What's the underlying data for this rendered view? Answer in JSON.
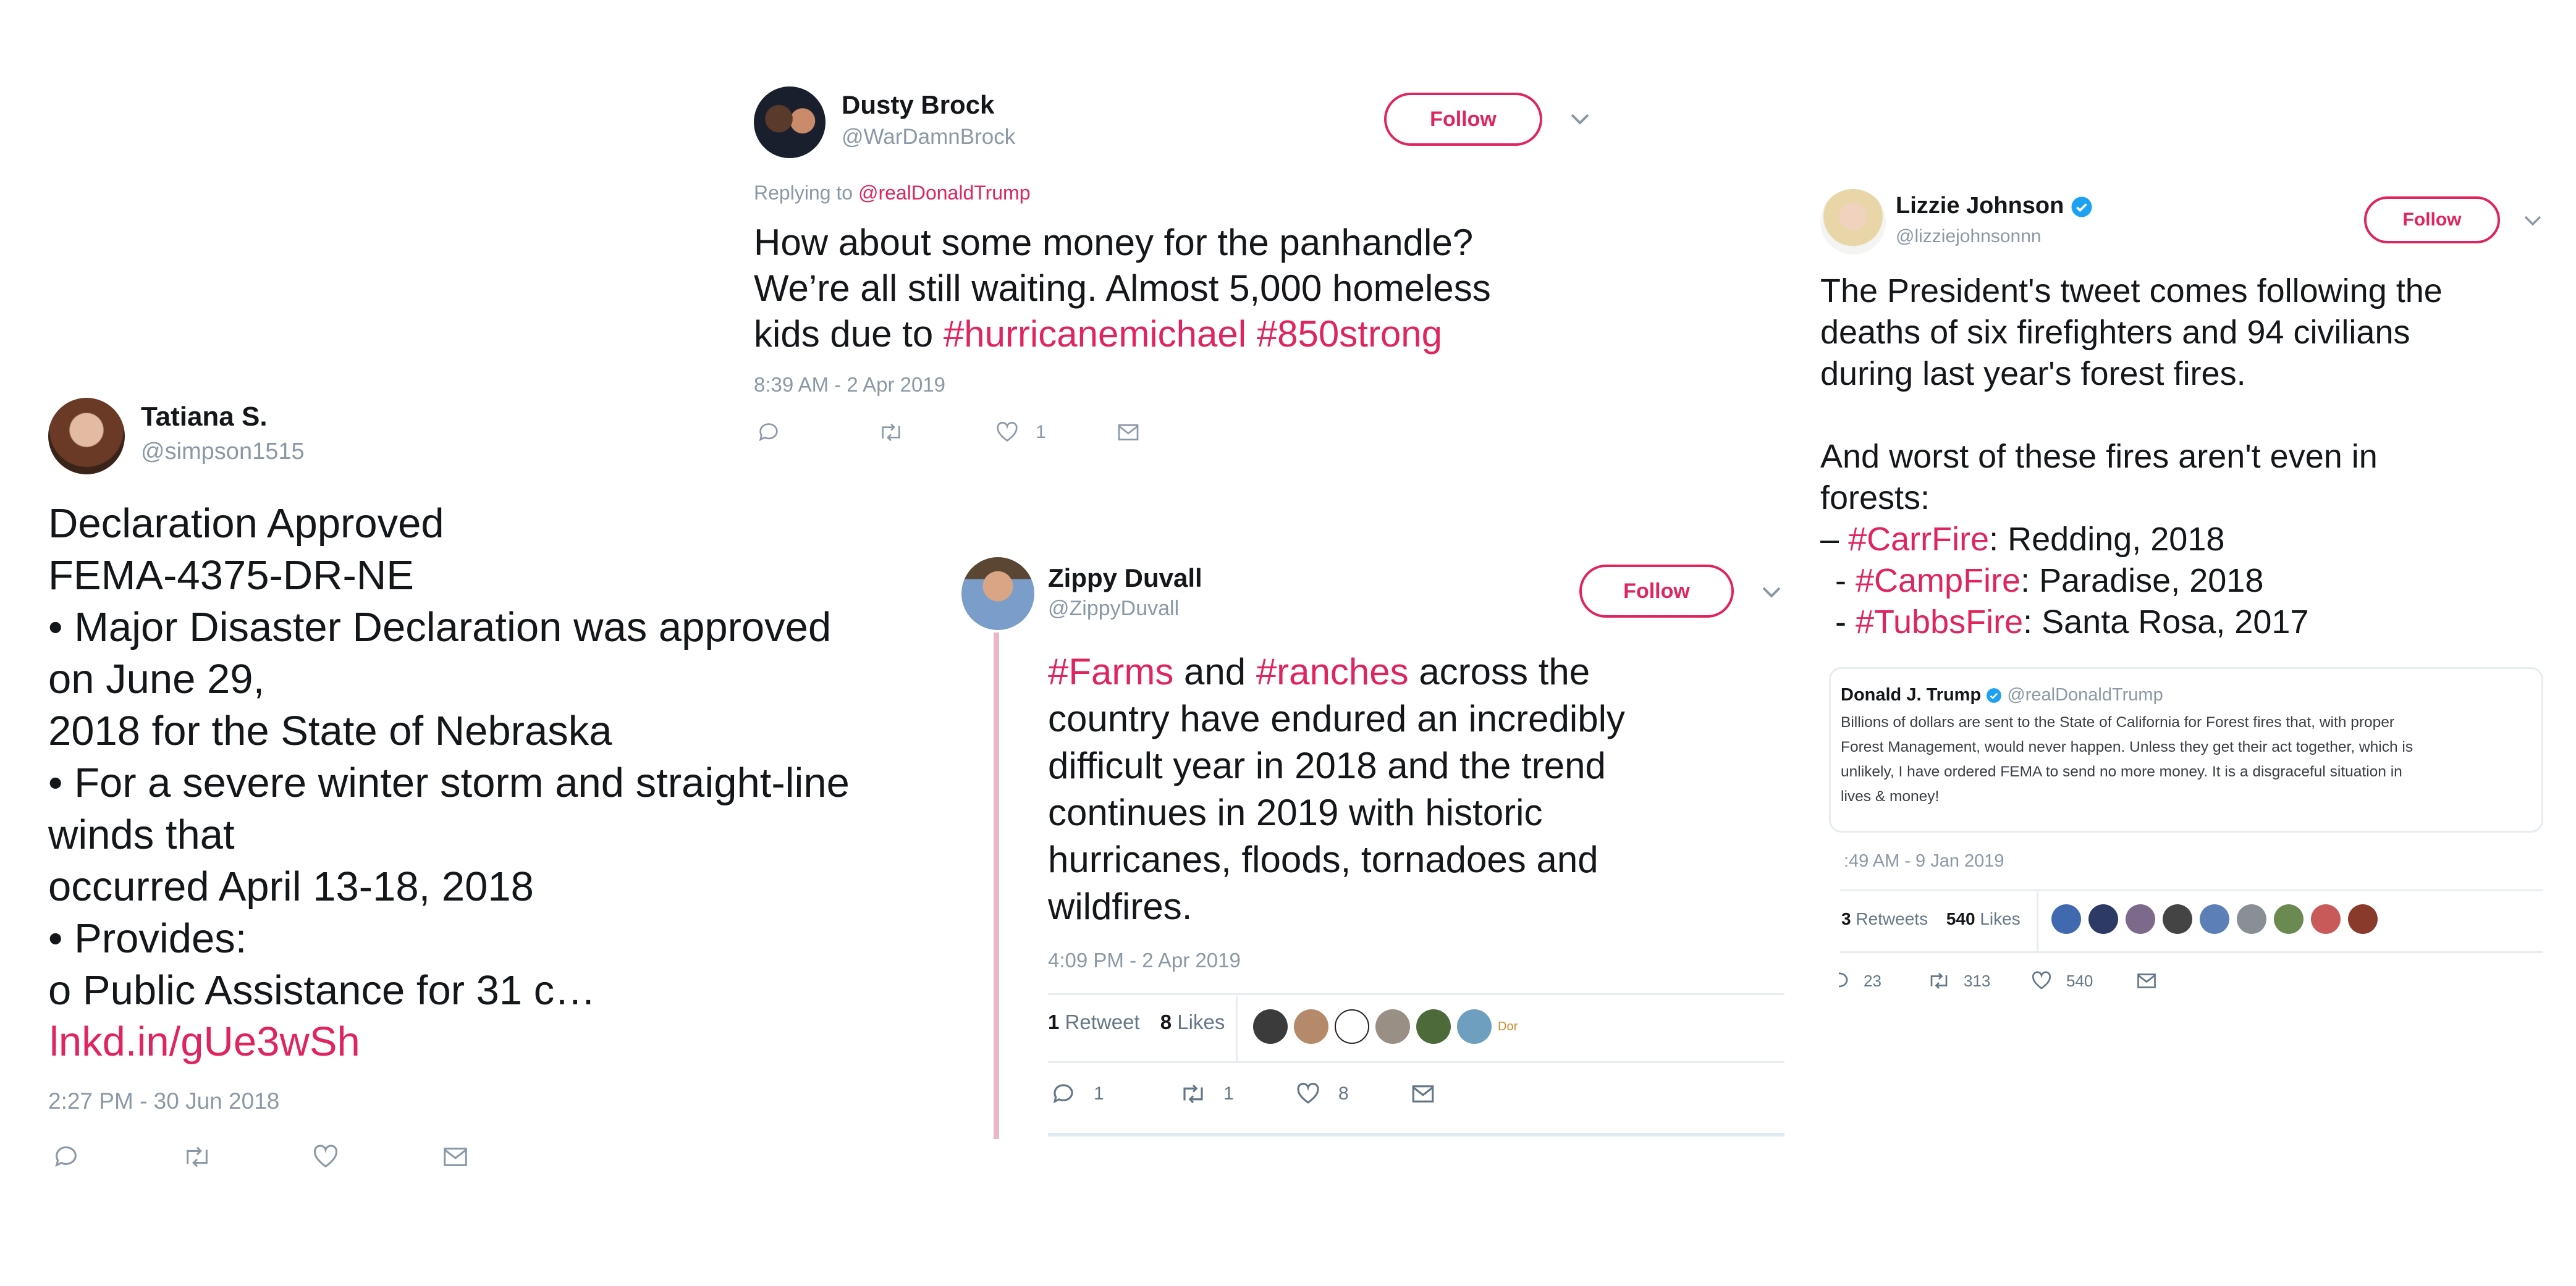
{
  "tweet_tatiana": {
    "name": "Tatiana S.",
    "handle": "@simpson1515",
    "lines": [
      "Declaration Approved",
      "FEMA-4375-DR-NE",
      "• Major Disaster Declaration was approved",
      "on June 29,",
      "2018 for the State of Nebraska",
      "• For a severe winter storm and straight-line",
      "winds that",
      "occurred April 13-18, 2018",
      "• Provides:",
      "o Public Assistance for 31 c…"
    ],
    "link": "lnkd.in/gUe3wSh",
    "timestamp": "2:27 PM - 30 Jun 2018"
  },
  "tweet_dusty": {
    "name": "Dusty Brock",
    "handle": "@WarDamnBrock",
    "follow_label": "Follow",
    "replying_prefix": "Replying to",
    "replying_to": "@realDonaldTrump",
    "line1": "How about some money for the panhandle?",
    "line2": "We’re all still waiting. Almost 5,000 homeless",
    "line3_prefix": "kids due to",
    "hashtag1": "#hurricanemichael",
    "hashtag2": "#850strong",
    "timestamp": "8:39 AM - 2 Apr 2019",
    "like_count": "1"
  },
  "tweet_zippy": {
    "name": "Zippy Duvall",
    "handle": "@ZippyDuvall",
    "follow_label": "Follow",
    "hashtag_farms": "#Farms",
    "word_and": "and",
    "hashtag_ranches": "#ranches",
    "line1_rest": "across the",
    "rest_lines": [
      "country have endured an incredibly",
      "difficult year in 2018 and the trend",
      "continues in 2019 with historic",
      "hurricanes, floods, tornadoes and",
      "wildfires."
    ],
    "timestamp": "4:09 PM - 2 Apr 2019",
    "retweets_count": "1",
    "retweets_label": "Retweet",
    "likes_count": "8",
    "likes_label": "Likes",
    "liker_tag": "Dor",
    "reply_count": "1",
    "retweet_action_count": "1",
    "like_action_count": "8"
  },
  "tweet_lizzie": {
    "name": "Lizzie Johnson",
    "handle": "@lizziejohnsonnn",
    "follow_label": "Follow",
    "para1": [
      "The President's tweet comes following the",
      "deaths of six firefighters and 94 civilians",
      "during last year's forest fires."
    ],
    "para2": [
      "And worst of these fires aren't even in",
      "forests:"
    ],
    "fires": [
      {
        "bullet": "–",
        "tag": "#CarrFire",
        "rest": ": Redding, 2018"
      },
      {
        "bullet": "-",
        "tag": "#CampFire",
        "rest": ": Paradise, 2018"
      },
      {
        "bullet": "-",
        "tag": "#TubbsFire",
        "rest": ": Santa Rosa, 2017"
      }
    ],
    "quoted": {
      "name": "Donald J. Trump",
      "handle": "@realDonaldTrump",
      "lines": [
        "Billions of dollars are sent to the State of California for Forest fires that, with proper",
        "Forest Management, would never happen. Unless they get their act together, which is",
        "unlikely, I have ordered FEMA to send no more money. It is a disgraceful situation in",
        "lives & money!"
      ]
    },
    "timestamp": ":49 AM - 9 Jan 2019",
    "retweets_count": "3",
    "retweets_label": "Retweets",
    "likes_count": "540",
    "likes_label": "Likes",
    "reply_count": "23",
    "retweet_action_count": "313",
    "like_action_count": "540"
  },
  "colors": {
    "accent": "#e0245e",
    "muted": "#8b98a5",
    "text": "#14171a",
    "verified": "#1da1f2",
    "thread_line": "#e9b7c6"
  }
}
